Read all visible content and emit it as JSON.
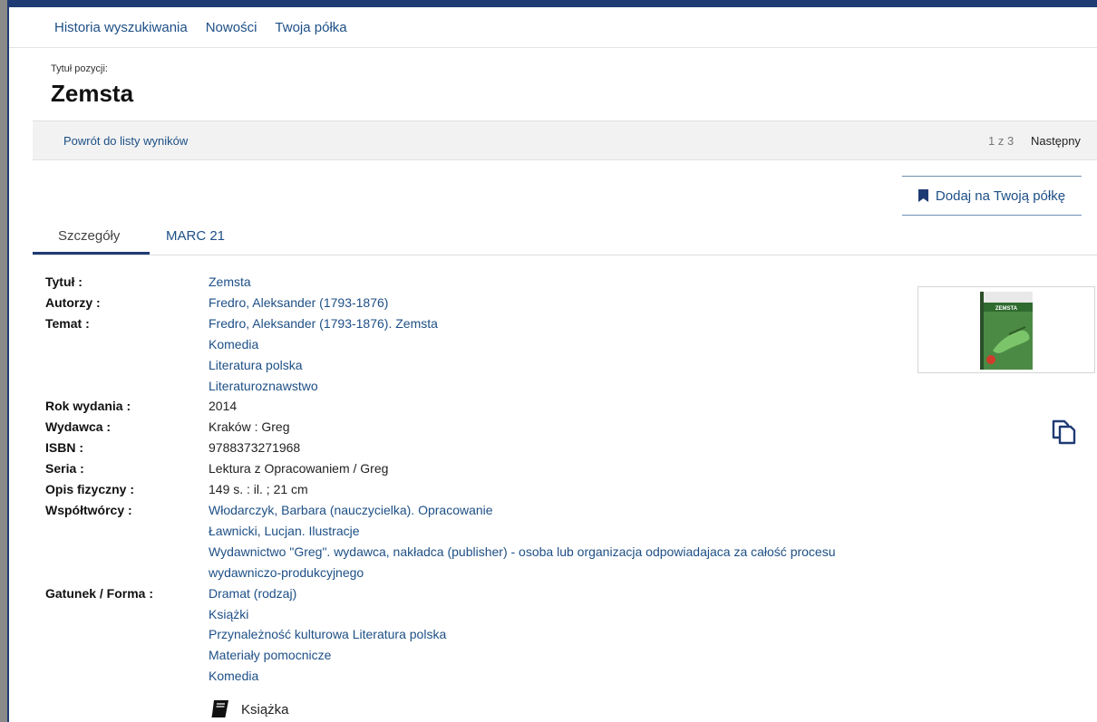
{
  "nav": {
    "items": [
      "Historia wyszukiwania",
      "Nowości",
      "Twoja półka"
    ]
  },
  "title": {
    "caption": "Tytuł pozycji:",
    "main": "Zemsta"
  },
  "results": {
    "back_label": "Powrót do listy wyników",
    "count": "1 z 3",
    "next_label": "Następny"
  },
  "shelf": {
    "label": "Dodaj na Twoją półkę",
    "icon": "bookmark-icon"
  },
  "tabs": {
    "details": "Szczegóły",
    "marc": "MARC 21"
  },
  "details": {
    "tytul_label": "Tytuł :",
    "tytul": "Zemsta",
    "autorzy_label": "Autorzy :",
    "autorzy": "Fredro, Aleksander (1793-1876)",
    "temat_label": "Temat :",
    "temat": [
      "Fredro, Aleksander (1793-1876). Zemsta",
      "Komedia",
      "Literatura polska",
      "Literaturoznawstwo"
    ],
    "rok_label": "Rok wydania :",
    "rok": "2014",
    "wydawca_label": "Wydawca :",
    "wydawca": "Kraków : Greg",
    "isbn_label": "ISBN :",
    "isbn": "9788373271968",
    "seria_label": "Seria :",
    "seria": "Lektura z Opracowaniem / Greg",
    "opis_label": "Opis fizyczny :",
    "opis": "149 s. : il. ; 21 cm",
    "wspol_label": "Współtwórcy :",
    "wspol": [
      "Włodarczyk, Barbara (nauczycielka). Opracowanie",
      "Ławnicki, Lucjan. Ilustracje",
      "Wydawnictwo \"Greg\". wydawca, nakładca (publisher) - osoba lub organizacja odpowiadajaca za całość procesu",
      "wydawniczo-produkcyjnego"
    ],
    "gatunek_label": "Gatunek / Forma :",
    "gatunek": [
      "Dramat (rodzaj)",
      "Książki",
      "Przynależność kulturowa Literatura polska",
      "Materiały pomocnicze",
      "Komedia"
    ]
  },
  "cover": {
    "banner_text": "ZEMSTA"
  },
  "copy": {
    "icon": "copy-icon"
  },
  "booktype": {
    "label": "Książka",
    "icon": "book-icon"
  },
  "colors": {
    "link": "#1d4f86",
    "accent": "#1f3b73",
    "cover_green": "#3f7d3f"
  }
}
